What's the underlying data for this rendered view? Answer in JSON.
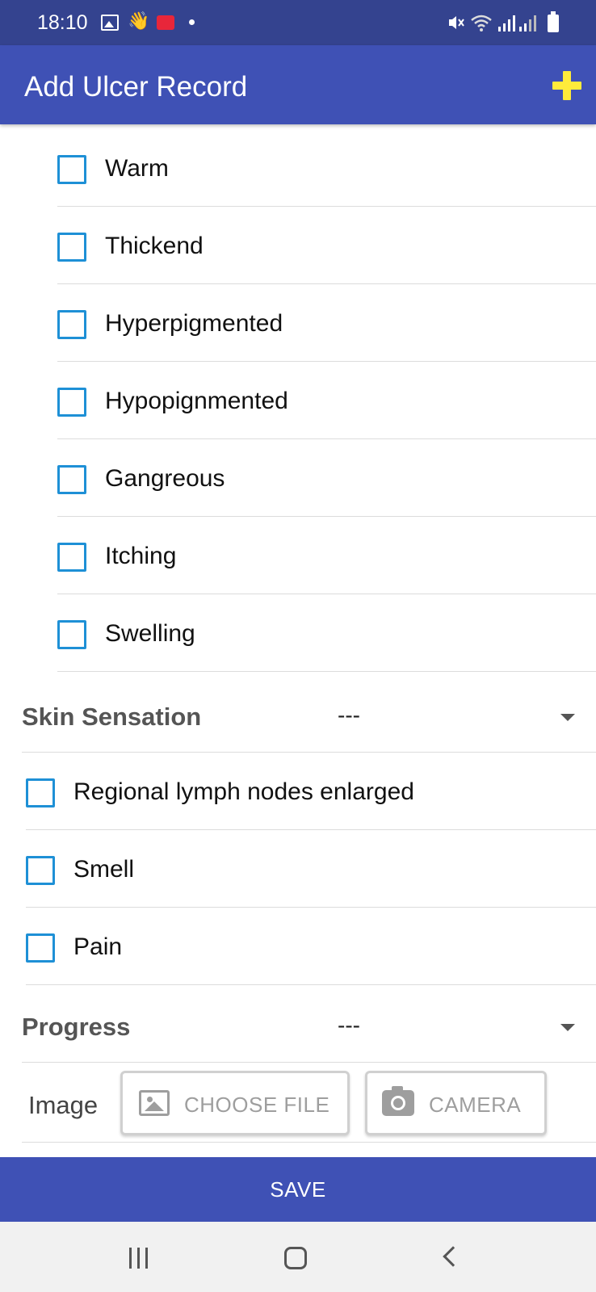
{
  "status_bar": {
    "time": "18:10"
  },
  "app_bar": {
    "title": "Add Ulcer Record",
    "add_icon": "plus-icon",
    "accent_color": "#ffeb3b",
    "bar_color": "#3f51b5"
  },
  "skin_checks": [
    {
      "label": "Warm",
      "checked": false
    },
    {
      "label": "Thickend",
      "checked": false
    },
    {
      "label": "Hyperpigmented",
      "checked": false
    },
    {
      "label": "Hypopignmented",
      "checked": false
    },
    {
      "label": "Gangreous",
      "checked": false
    },
    {
      "label": "Itching",
      "checked": false
    },
    {
      "label": "Swelling",
      "checked": false
    }
  ],
  "skin_sensation": {
    "label": "Skin Sensation",
    "value": "---"
  },
  "other_checks": [
    {
      "label": "Regional lymph nodes enlarged",
      "checked": false
    },
    {
      "label": "Smell",
      "checked": false
    },
    {
      "label": "Pain",
      "checked": false
    }
  ],
  "progress": {
    "label": "Progress",
    "value": "---"
  },
  "image": {
    "label": "Image",
    "choose_file_label": "CHOOSE FILE",
    "camera_label": "CAMERA"
  },
  "save": {
    "label": "SAVE"
  },
  "checkbox_color": "#1e90d6"
}
